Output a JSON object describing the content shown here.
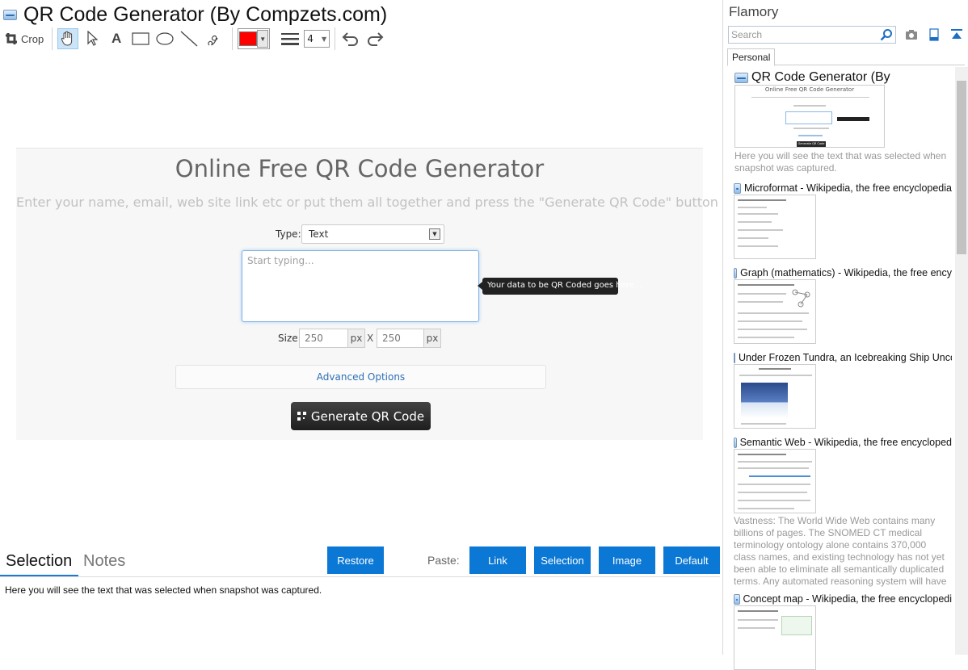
{
  "window": {
    "title": "QR Code Generator (By Compzets.com)"
  },
  "toolbar": {
    "crop_label": "Crop",
    "line_width": "4",
    "color": "#ff0000"
  },
  "capture": {
    "heading": "Online Free QR Code Generator",
    "subtitle": "Enter your name, email, web site link etc or put them all together and press the \"Generate QR Code\" button",
    "type_label": "Type:",
    "type_value": "Text",
    "textarea_placeholder": "Start typing...",
    "tooltip": "Your data to be QR Coded goes here...",
    "size_label": "Size:",
    "width_value": "250",
    "height_value": "250",
    "px_unit": "px",
    "x_separator": "X",
    "advanced_options": "Advanced Options",
    "generate_button": "Generate QR Code"
  },
  "bottom": {
    "tab_selection": "Selection",
    "tab_notes": "Notes",
    "restore": "Restore",
    "paste_label": "Paste:",
    "paste_link": "Link",
    "paste_selection": "Selection",
    "paste_image": "Image",
    "paste_default": "Default",
    "selection_text": "Here you will see the text that was selected when snapshot was captured."
  },
  "panel": {
    "app_name": "Flamory",
    "search_placeholder": "Search",
    "tab_personal": "Personal",
    "items": [
      {
        "title": "QR Code Generator (By",
        "thumb_caption": "Online Free QR Code Generator",
        "thumb_button": "Generate QR Code",
        "desc": "Here you will see the text that was selected when snapshot was captured."
      },
      {
        "title": "Microformat - Wikipedia, the free encyclopedia"
      },
      {
        "title": "Graph (mathematics) - Wikipedia, the free ency"
      },
      {
        "title": "Under Frozen Tundra, an Icebreaking Ship Unco"
      },
      {
        "title": "Semantic Web - Wikipedia, the free encycloped",
        "desc": "Vastness: The World Wide Web contains many billions of pages. The SNOMED CT medical terminology ontology alone contains 370,000 class names, and existing technology has not yet been able to eliminate all semantically duplicated terms. Any automated reasoning system will have to deal with truly huge inputs."
      },
      {
        "title": "Concept map - Wikipedia, the free encyclopedi"
      }
    ]
  },
  "colors": {
    "accent": "#0a78d4",
    "tab_underline": "#1e7ad1"
  }
}
